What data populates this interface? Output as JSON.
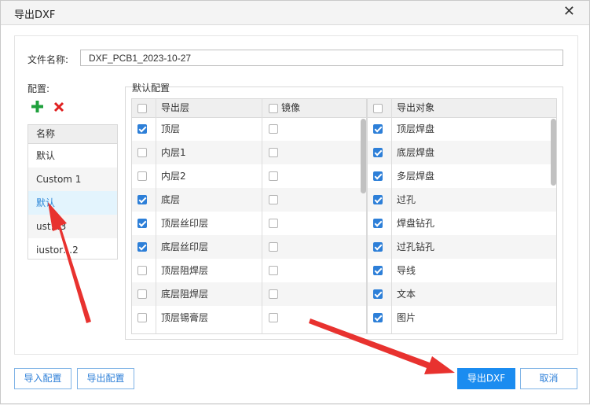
{
  "window": {
    "title": "导出DXF",
    "close_glyph": "✕"
  },
  "file_name": {
    "label": "文件名称:",
    "value": "DXF_PCB1_2023-10-27"
  },
  "config": {
    "label": "配置:",
    "column_header": "名称",
    "items": [
      {
        "label": "默认"
      },
      {
        "label": "Custom 1"
      },
      {
        "label": "默认"
      },
      {
        "label": "ust…3"
      },
      {
        "label": "iustor…2"
      }
    ]
  },
  "default_config": {
    "group_label": "默认配置",
    "layers_table": {
      "headers": {
        "layer": "导出层",
        "mirror": "镜像"
      },
      "rows": [
        {
          "name": "顶层",
          "export": true,
          "mirror": false
        },
        {
          "name": "内层1",
          "export": false,
          "mirror": false
        },
        {
          "name": "内层2",
          "export": false,
          "mirror": false
        },
        {
          "name": "底层",
          "export": true,
          "mirror": false
        },
        {
          "name": "顶层丝印层",
          "export": true,
          "mirror": false
        },
        {
          "name": "底层丝印层",
          "export": true,
          "mirror": false
        },
        {
          "name": "顶层阻焊层",
          "export": false,
          "mirror": false
        },
        {
          "name": "底层阻焊层",
          "export": false,
          "mirror": false
        },
        {
          "name": "顶层锡膏层",
          "export": false,
          "mirror": false
        }
      ]
    },
    "objects_table": {
      "header": "导出对象",
      "rows": [
        {
          "name": "顶层焊盘",
          "checked": true
        },
        {
          "name": "底层焊盘",
          "checked": true
        },
        {
          "name": "多层焊盘",
          "checked": true
        },
        {
          "name": "过孔",
          "checked": true
        },
        {
          "name": "焊盘钻孔",
          "checked": true
        },
        {
          "name": "过孔钻孔",
          "checked": true
        },
        {
          "name": "导线",
          "checked": true
        },
        {
          "name": "文本",
          "checked": true
        },
        {
          "name": "图片",
          "checked": true
        }
      ]
    }
  },
  "buttons": {
    "import": "导入配置",
    "export_config": "导出配置",
    "export_dxf": "导出DXF",
    "cancel": "取消"
  },
  "colors": {
    "accent": "#1b8cf0",
    "add": "#1fa03c",
    "delete": "#e02020",
    "annotation_arrow": "#e8322f"
  }
}
